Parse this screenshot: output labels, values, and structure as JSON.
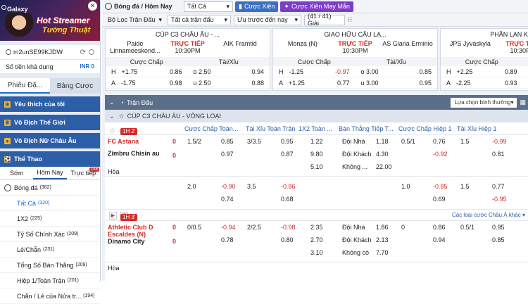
{
  "sidebar": {
    "banner": {
      "title": "Galaxy",
      "line1": "Hot Streamer",
      "line2": "Tướng Thuật",
      "close": "✕"
    },
    "username": "m2unSE99KJDW",
    "balance_label": "Số tiền khả dụng",
    "balance_value": "INR 0",
    "tabs": [
      "Phiếu Đặ...",
      "Bảng Cược"
    ],
    "categories": [
      "Yêu thích của tôi",
      "Vô Địch Thế Giới",
      "Vô Địch Nữ Châu Âu",
      "Thể Thao"
    ],
    "sport_tabs": [
      "Sớm",
      "Hôm Nay",
      "Trực tiếp"
    ],
    "live_count": "146",
    "football": {
      "label": "Bóng đá",
      "count": "(382)"
    },
    "markets": [
      {
        "label": "Tất Cả",
        "count": "(320)"
      },
      {
        "label": "1X2",
        "count": "(225)"
      },
      {
        "label": "Tỷ Số Chính Xác",
        "count": "(209)"
      },
      {
        "label": "Lẻ/Chẵn",
        "count": "(231)"
      },
      {
        "label": "Tổng Số Bàn Thắng",
        "count": "(209)"
      },
      {
        "label": "Hiệp 1/Toàn Trận",
        "count": "(201)"
      },
      {
        "label": "Chẵn / Lẻ của Nửa tr...",
        "count": "(194)"
      }
    ]
  },
  "toolbar": {
    "sport": "Bóng đá / Hôm Nay",
    "filter": "Tất Cả",
    "btn_parlay": "Cược Xiên",
    "btn_lucky": "Cược Xiên May Mắn",
    "match_filter": "Bộ Lọc Trận Đấu",
    "all_matches": "Tất cả trận đấu",
    "sort": "Ưu trước đến nay",
    "count": "(41 / 41) Giải"
  },
  "cards": [
    {
      "league": "CÚP C3 CHÂU ÂU - ...",
      "home": "Paide Linnameeskond...",
      "away": "AIK Framtid",
      "live": "TRỰC TIẾP",
      "time": "10:30PM",
      "h1": "Cược Chấp",
      "h2": "Tài/Xỉu",
      "rows": [
        {
          "s": "H",
          "hc": "+1.75",
          "o1": "0.86",
          "ou": "o 2.50",
          "o2": "0.94",
          "c1": "",
          "c2": ""
        },
        {
          "s": "A",
          "hc": "-1.75",
          "o1": "0.98",
          "ou": "u 2.50",
          "o2": "0.88",
          "c1": "",
          "c2": ""
        }
      ]
    },
    {
      "league": "GIAO HỮU CÂU LẠ...",
      "home": "Monza (N)",
      "away": "AS Giana Erminio",
      "live": "TRỰC TIẾP",
      "time": "10:30PM",
      "h1": "Cược Chấp",
      "h2": "Tài/Xỉu",
      "rows": [
        {
          "s": "H",
          "hc": "-1.25",
          "o1": "-0.97",
          "ou": "o 3.00",
          "o2": "0.85",
          "c1": "red",
          "c2": ""
        },
        {
          "s": "A",
          "hc": "+1.25",
          "o1": "0.77",
          "ou": "u 3.00",
          "o2": "0.95",
          "c1": "",
          "c2": ""
        }
      ]
    },
    {
      "league": "PHẦN LAN KAKKON...",
      "home": "JPS Jyvaskyla",
      "away": "",
      "live": "TRỰC TIẾP",
      "time": "10:30PM",
      "h1": "Cược Chấp",
      "h2": "Tài/Xỉu",
      "rows": [
        {
          "s": "H",
          "hc": "+2.25",
          "o1": "0.89",
          "ou": "o 4.50",
          "o2": "",
          "c1": "",
          "c2": ""
        },
        {
          "s": "A",
          "hc": "-2.25",
          "o1": "0.93",
          "ou": "u 4.50",
          "o2": "",
          "c1": "",
          "c2": ""
        }
      ]
    }
  ],
  "section": {
    "title": "Trận Đấu",
    "view": "Lựa chọn bình thường",
    "league": "CÚP C3 CHÂU ÂU - VÒNG LOẠI"
  },
  "columns": [
    "Cược Chấp Toàn...",
    "Tài Xỉu Toàn Trận",
    "1X2 Toàn ...",
    "Bàn Thắng Tiếp T...",
    "Cược Chấp Hiệp 1",
    "Tài Xỉu Hiệp 1"
  ],
  "match1": {
    "badge": "1H 2'",
    "home": "FC Astana",
    "away": "Zimbru Chisin au",
    "draw": "Hòa",
    "hs": "0",
    "as": "0",
    "r1": [
      "1.5/2",
      "0.85",
      "3/3.5",
      "0.95",
      "1.22",
      "Đội Nhà",
      "1.18",
      "0.5/1",
      "0.76",
      "1.5",
      "-0.99"
    ],
    "r2": [
      "",
      "0.97",
      "",
      "0.87",
      "9.80",
      "Đội Khách",
      "4.30",
      "",
      "-0.92",
      "",
      "0.81"
    ],
    "r3": [
      "5.10",
      "Không ...",
      "22.00"
    ],
    "r4": [
      "2.0",
      "-0.90",
      "3.5",
      "-0.86",
      "",
      "1.0",
      "-0.85",
      "1.5",
      "0.77"
    ],
    "r5": [
      "",
      "0.74",
      "",
      "0.68",
      "",
      "",
      "0.69",
      "",
      "-0.95"
    ]
  },
  "more_link": "Các loại cược Châu Á khác",
  "match2": {
    "badge": "1H 3'",
    "home": "Athletic Club D Escaldes (N)",
    "away": "Dinamo City",
    "draw": "Hòa",
    "hs": "0",
    "as": "0",
    "r1": [
      "0/0.5",
      "-0.94",
      "2/2.5",
      "-0.98",
      "2.35",
      "Đội Nhà",
      "1.86",
      "0",
      "0.86",
      "0.5/1",
      "0.95"
    ],
    "r2": [
      "",
      "0.78",
      "",
      "0.80",
      "2.70",
      "Đội Khách",
      "2.13",
      "",
      "0.94",
      "",
      "0.85"
    ],
    "r3": [
      "3.10",
      "Không có",
      "7.70"
    ]
  }
}
